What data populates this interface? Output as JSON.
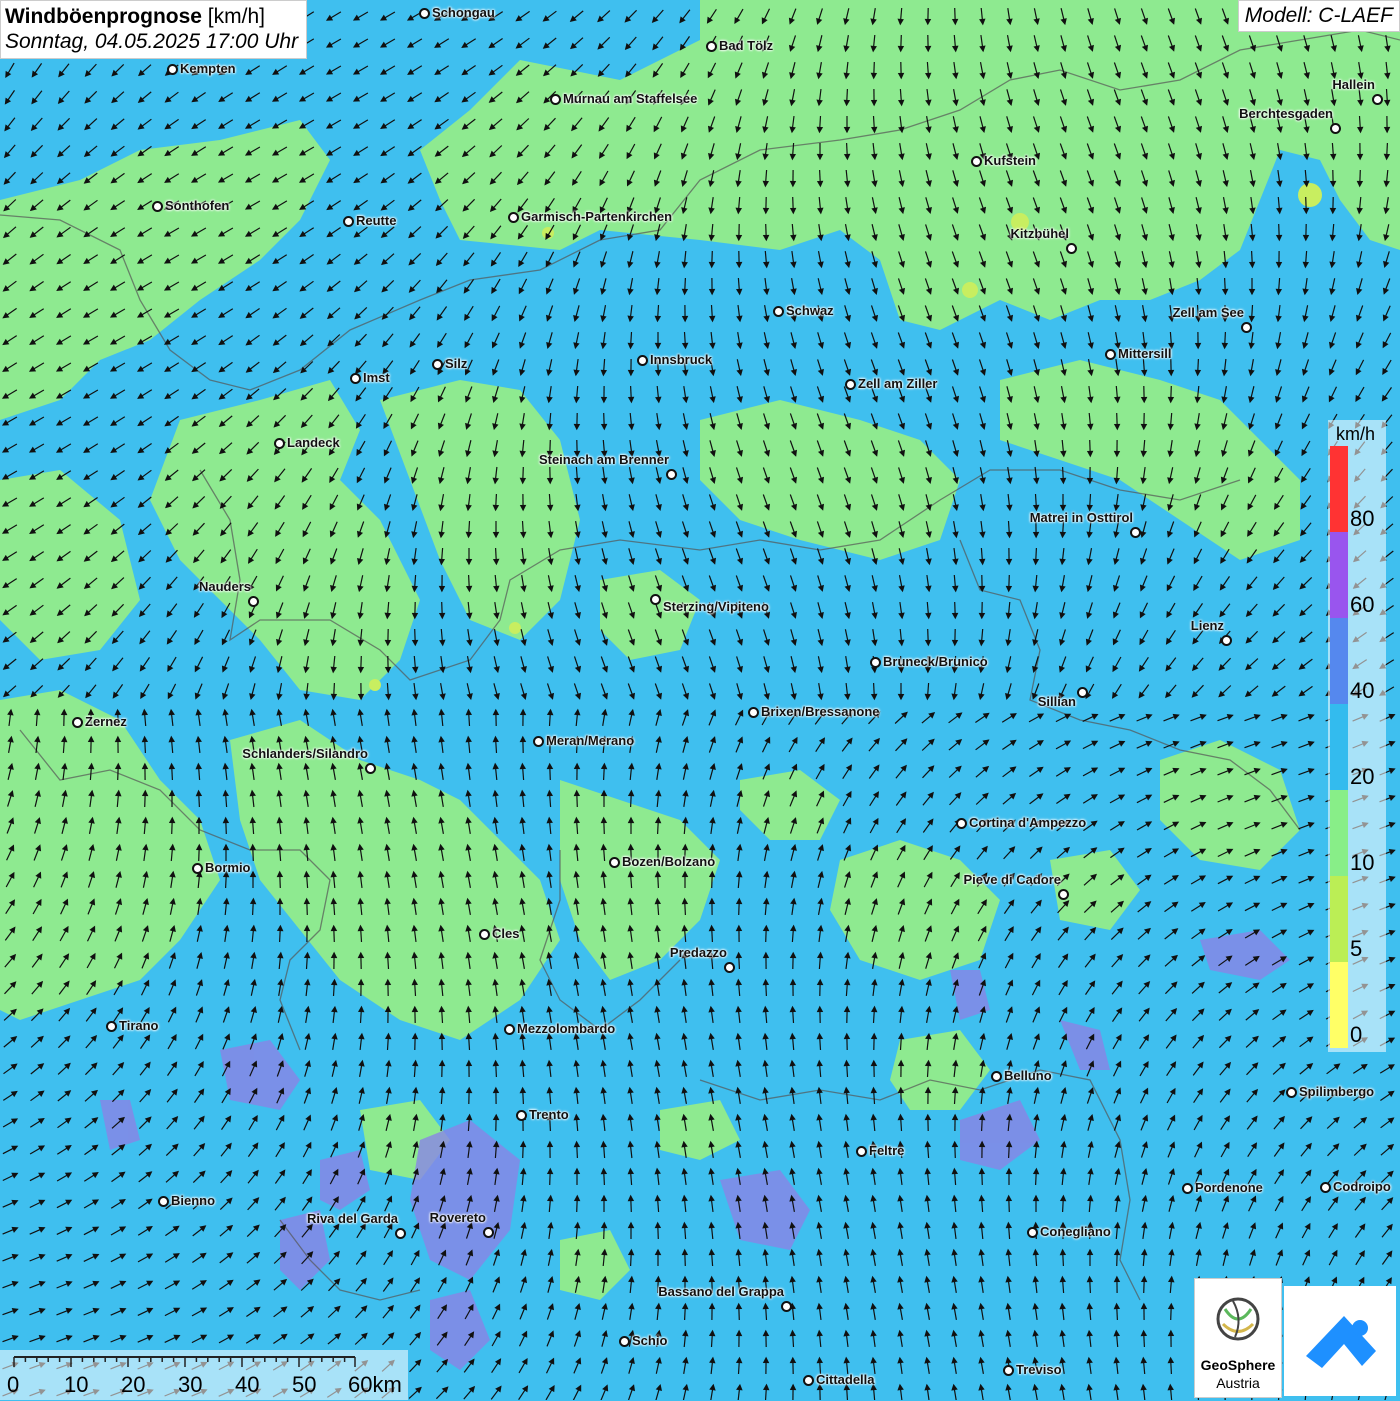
{
  "title": {
    "bold": "Windböenprognose",
    "unit": " [km/h]",
    "subtitle": "Sonntag, 04.05.2025 17:00 Uhr"
  },
  "model": "Modell: C-LAEF",
  "legend": {
    "unit": "km/h",
    "ticks": [
      "80",
      "60",
      "40",
      "20",
      "10",
      "5",
      "0"
    ],
    "colors": [
      "#ff3333",
      "#9955ee",
      "#5588ee",
      "#33bbee",
      "#88ee88",
      "#bbee55",
      "#ffff66"
    ]
  },
  "scale": {
    "labels": [
      "0",
      "10",
      "20",
      "30",
      "40",
      "50",
      "60km"
    ]
  },
  "logos": {
    "geosphere_line1": "GeoSphere",
    "geosphere_line2": "Austria"
  },
  "cities": [
    {
      "name": "Schongau"
    },
    {
      "name": "Bad Tölz"
    },
    {
      "name": "Kempten"
    },
    {
      "name": "Murnau am Staffelsee"
    },
    {
      "name": "Hallein"
    },
    {
      "name": "Berchtesgaden"
    },
    {
      "name": "Kufstein"
    },
    {
      "name": "Sonthofen"
    },
    {
      "name": "Reutte"
    },
    {
      "name": "Garmisch-Partenkirchen"
    },
    {
      "name": "Kitzbühel"
    },
    {
      "name": "Schwaz"
    },
    {
      "name": "Zell am See"
    },
    {
      "name": "Mittersill"
    },
    {
      "name": "Innsbruck"
    },
    {
      "name": "Imst"
    },
    {
      "name": "Silz"
    },
    {
      "name": "Zell am Ziller"
    },
    {
      "name": "Landeck"
    },
    {
      "name": "Steinach am Brenner"
    },
    {
      "name": "Matrei in Osttirol"
    },
    {
      "name": "Nauders"
    },
    {
      "name": "Sterzing/Vipiteno"
    },
    {
      "name": "Lienz"
    },
    {
      "name": "Bruneck/Brunico"
    },
    {
      "name": "Sillian"
    },
    {
      "name": "Zernez"
    },
    {
      "name": "Brixen/Bressanone"
    },
    {
      "name": "Meran/Merano"
    },
    {
      "name": "Schlanders/Silandro"
    },
    {
      "name": "Cortina d'Ampezzo"
    },
    {
      "name": "Bozen/Bolzano"
    },
    {
      "name": "Bormio"
    },
    {
      "name": "Pieve di Cadore"
    },
    {
      "name": "Cles"
    },
    {
      "name": "Predazzo"
    },
    {
      "name": "Tirano"
    },
    {
      "name": "Mezzolombardo"
    },
    {
      "name": "Belluno"
    },
    {
      "name": "Spilimbergo"
    },
    {
      "name": "Trento"
    },
    {
      "name": "Feltre"
    },
    {
      "name": "Bienno"
    },
    {
      "name": "Pordenone"
    },
    {
      "name": "Codroipo"
    },
    {
      "name": "Riva del Garda"
    },
    {
      "name": "Rovereto"
    },
    {
      "name": "Conegliano"
    },
    {
      "name": "Bassano del Grappa"
    },
    {
      "name": "Schio"
    },
    {
      "name": "Treviso"
    },
    {
      "name": "Cittadella"
    }
  ]
}
